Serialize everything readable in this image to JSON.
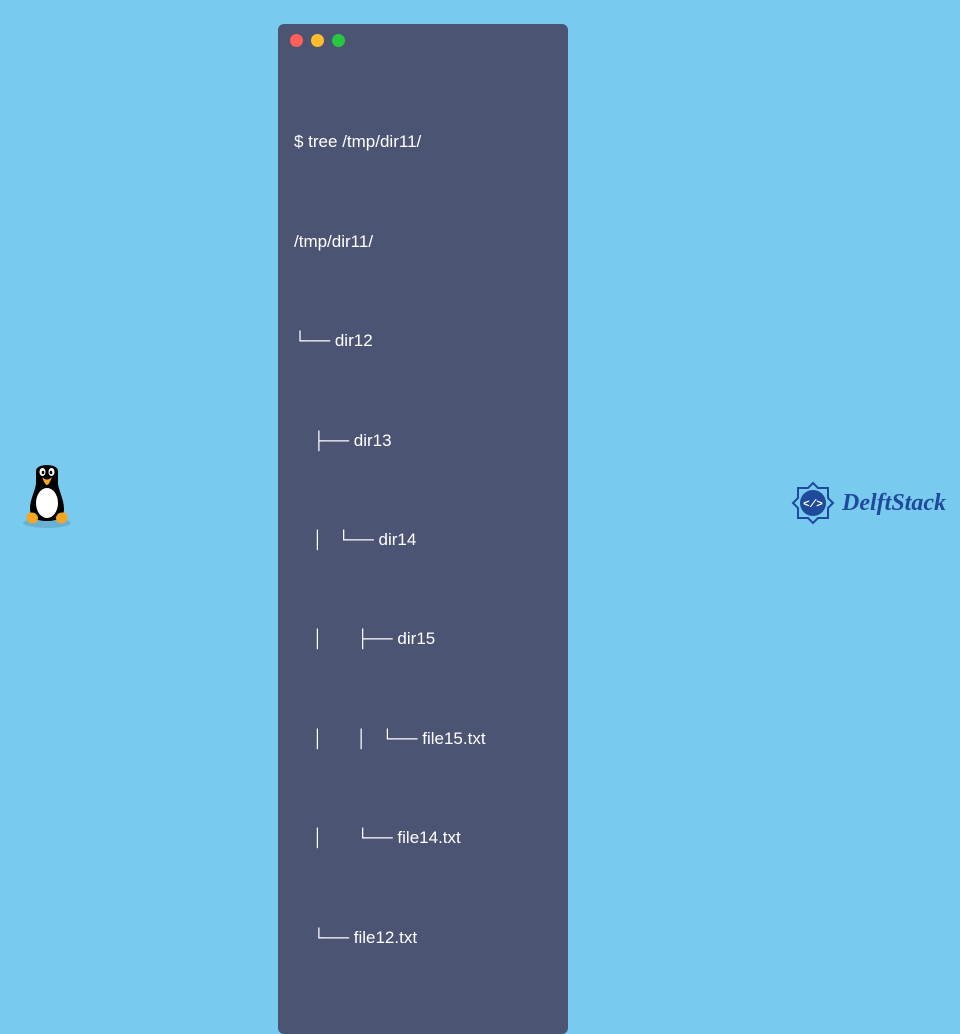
{
  "terminal": {
    "command": "$ tree /tmp/dir11/",
    "output": [
      "/tmp/dir11/",
      "└── dir12",
      "    ├── dir13",
      "    │   └── dir14",
      "    │       ├── dir15",
      "    │       │   └── file15.txt",
      "    │       └── file14.txt",
      "    └── file12.txt"
    ]
  },
  "branding": {
    "logo_text": "DelftStack"
  },
  "colors": {
    "background": "#78caef",
    "terminal_bg": "#4c5474",
    "text": "#ffffff",
    "dot_red": "#ff5f56",
    "dot_yellow": "#ffbd2e",
    "dot_green": "#27c93f",
    "brand": "#1f4a9b"
  }
}
